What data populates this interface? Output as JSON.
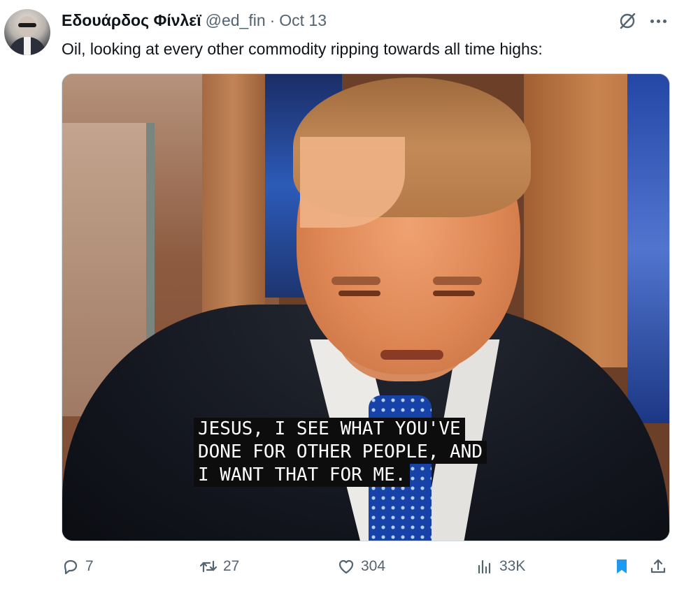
{
  "tweet": {
    "display_name": "Εδουάρδος Φίνλεϊ",
    "handle": "@ed_fin",
    "separator": "·",
    "date": "Oct 13",
    "text": "Oil, looking at every other commodity ripping towards all time highs:"
  },
  "media": {
    "caption_lines": [
      "JESUS, I SEE WHAT YOU'VE",
      "DONE FOR OTHER PEOPLE, AND",
      "I WANT THAT FOR ME."
    ]
  },
  "actions": {
    "replies": "7",
    "reposts": "27",
    "likes": "304",
    "views": "33K"
  },
  "icons": {
    "grok": "grok-icon",
    "more": "more-icon",
    "reply": "reply-icon",
    "repost": "repost-icon",
    "like": "heart-icon",
    "views": "views-icon",
    "bookmark": "bookmark-icon",
    "share": "share-icon"
  },
  "colors": {
    "text_primary": "#0f1419",
    "text_secondary": "#536471",
    "accent": "#1d9bf0"
  }
}
